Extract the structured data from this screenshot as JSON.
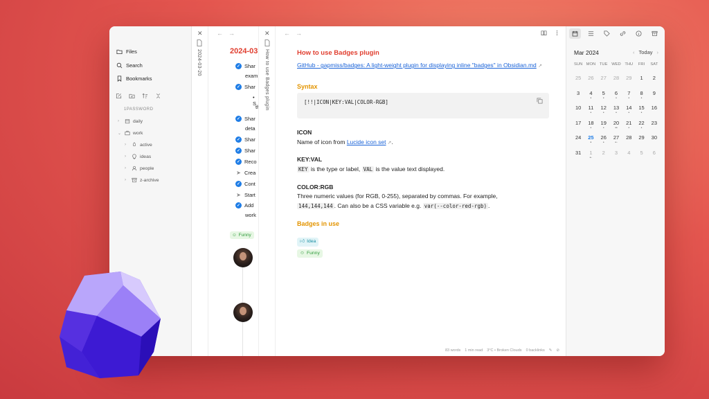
{
  "sidebar": {
    "files": "Files",
    "search": "Search",
    "bookmarks": "Bookmarks",
    "vault": "1PASSWORD",
    "tree": [
      {
        "label": "daily",
        "chev": "›"
      },
      {
        "label": "work",
        "chev": "⌄"
      },
      {
        "label": "active",
        "chev": "›"
      },
      {
        "label": "ideas",
        "chev": "›"
      },
      {
        "label": "people",
        "chev": "›"
      },
      {
        "label": "z-archive",
        "chev": "›"
      }
    ]
  },
  "panel1": {
    "vertical_title": "2024-03-20",
    "title": "2024-03",
    "tasks": [
      "Shar",
      "exam",
      "Shar",
      "S",
      "th",
      "Shar",
      "deta",
      "Shar",
      "Shar",
      "Reco",
      "Crea",
      "Cont",
      "Start",
      "Add",
      "work"
    ],
    "badge": "Funny"
  },
  "main": {
    "vertical_title": "How to use Badges plugin",
    "title": "How to use Badges plugin",
    "link_text": "GitHub - gapmiss/badges: A light-weight plugin for displaying inline \"badges\" in Obsidian.md",
    "syntax_heading": "Syntax",
    "code": "[!!|ICON|KEY:VAL|COLOR-RGB]",
    "icon_heading": "ICON",
    "icon_text_before": "Name of icon from ",
    "icon_link": "Lucide icon set",
    "icon_text_after": ".",
    "keyval_heading": "KEY:VAL",
    "keyval_code1": "KEY",
    "keyval_text1": " is the type or label, ",
    "keyval_code2": "VAL",
    "keyval_text2": " is the value text displayed.",
    "color_heading": "COLOR:RGB",
    "color_text1": "Three numeric values (for RGB, 0-255), separated by commas. For example,",
    "color_code1": "144,144,144",
    "color_text2": ". Can also be a CSS variable e.g. ",
    "color_code2": "var(--color-red-rgb)",
    "color_text3": ".",
    "badges_heading": "Badges in use",
    "badge_idea": "Idea",
    "badge_funny": "Funny",
    "status": {
      "words": "83 words",
      "read": "1 min read",
      "weather": "3°C • Broken Clouds",
      "backlinks": "0 backlinks"
    }
  },
  "calendar": {
    "month": "Mar 2024",
    "today_label": "Today",
    "weekdays": [
      "SUN",
      "MON",
      "TUE",
      "WED",
      "THU",
      "FRI",
      "SAT"
    ],
    "days": [
      {
        "d": "25",
        "m": true,
        "dots": ""
      },
      {
        "d": "26",
        "m": true,
        "dots": ""
      },
      {
        "d": "27",
        "m": true,
        "dots": ""
      },
      {
        "d": "28",
        "m": true,
        "dots": ""
      },
      {
        "d": "29",
        "m": true,
        "dots": ""
      },
      {
        "d": "1",
        "m": false,
        "dots": ""
      },
      {
        "d": "2",
        "m": false,
        "dots": ""
      },
      {
        "d": "3",
        "m": false,
        "dots": ""
      },
      {
        "d": "4",
        "m": false,
        "dots": "•"
      },
      {
        "d": "5",
        "m": false,
        "dots": "•"
      },
      {
        "d": "6",
        "m": false,
        "dots": "•"
      },
      {
        "d": "7",
        "m": false,
        "dots": "•"
      },
      {
        "d": "8",
        "m": false,
        "dots": "•"
      },
      {
        "d": "9",
        "m": false,
        "dots": ""
      },
      {
        "d": "10",
        "m": false,
        "dots": ""
      },
      {
        "d": "11",
        "m": false,
        "dots": "•"
      },
      {
        "d": "12",
        "m": false,
        "dots": "•"
      },
      {
        "d": "13",
        "m": false,
        "dots": "•"
      },
      {
        "d": "14",
        "m": false,
        "dots": "•"
      },
      {
        "d": "15",
        "m": false,
        "dots": "•"
      },
      {
        "d": "16",
        "m": false,
        "dots": ""
      },
      {
        "d": "17",
        "m": false,
        "dots": ""
      },
      {
        "d": "18",
        "m": false,
        "dots": "•"
      },
      {
        "d": "19",
        "m": false,
        "dots": "•"
      },
      {
        "d": "20",
        "m": false,
        "dots": "••"
      },
      {
        "d": "21",
        "m": false,
        "dots": "•"
      },
      {
        "d": "22",
        "m": false,
        "dots": "•"
      },
      {
        "d": "23",
        "m": false,
        "dots": ""
      },
      {
        "d": "24",
        "m": false,
        "dots": ""
      },
      {
        "d": "25",
        "m": false,
        "dots": "•",
        "today": true
      },
      {
        "d": "26",
        "m": false,
        "dots": "•"
      },
      {
        "d": "27",
        "m": false,
        "dots": "•◦"
      },
      {
        "d": "28",
        "m": false,
        "dots": ""
      },
      {
        "d": "29",
        "m": false,
        "dots": ""
      },
      {
        "d": "30",
        "m": false,
        "dots": ""
      },
      {
        "d": "31",
        "m": false,
        "dots": ""
      },
      {
        "d": "1",
        "m": true,
        "dots": "•◦"
      },
      {
        "d": "2",
        "m": true,
        "dots": ""
      },
      {
        "d": "3",
        "m": true,
        "dots": ""
      },
      {
        "d": "4",
        "m": true,
        "dots": ""
      },
      {
        "d": "5",
        "m": true,
        "dots": ""
      },
      {
        "d": "6",
        "m": true,
        "dots": ""
      }
    ]
  },
  "colors": {
    "accent_red": "#e03d2e",
    "accent_orange": "#e39400",
    "link_blue": "#1a63d8",
    "check_blue": "#1f7de6",
    "logo_purple": "#5b3de0"
  }
}
